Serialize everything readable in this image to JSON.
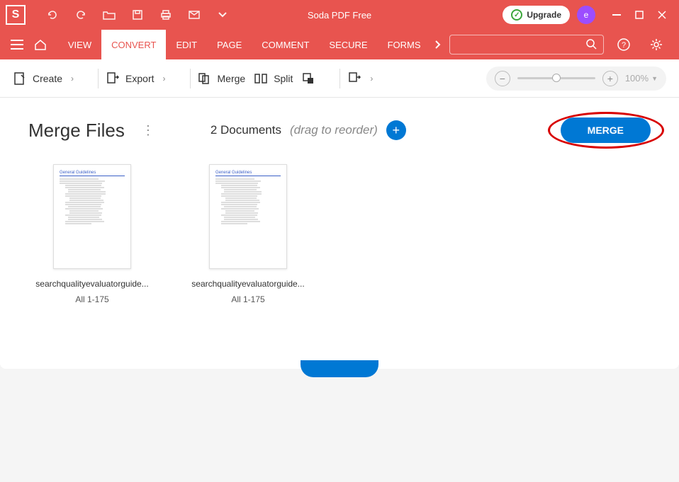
{
  "app": {
    "title": "Soda PDF Free",
    "logo_letter": "S",
    "upgrade_label": "Upgrade",
    "avatar_letter": "e"
  },
  "tabs": [
    "VIEW",
    "CONVERT",
    "EDIT",
    "PAGE",
    "COMMENT",
    "SECURE",
    "FORMS"
  ],
  "active_tab": "CONVERT",
  "toolbar": {
    "create": "Create",
    "export": "Export",
    "merge": "Merge",
    "split": "Split"
  },
  "zoom": {
    "percent": "100%"
  },
  "workspace": {
    "title": "Merge Files",
    "doc_count_label": "2 Documents",
    "drag_hint": "(drag to reorder)",
    "merge_button": "MERGE"
  },
  "documents": [
    {
      "name": "searchqualityevaluatorguide...",
      "range": "All 1-175",
      "thumb_heading": "General Guidelines"
    },
    {
      "name": "searchqualityevaluatorguide...",
      "range": "All 1-175",
      "thumb_heading": "General Guidelines"
    }
  ]
}
